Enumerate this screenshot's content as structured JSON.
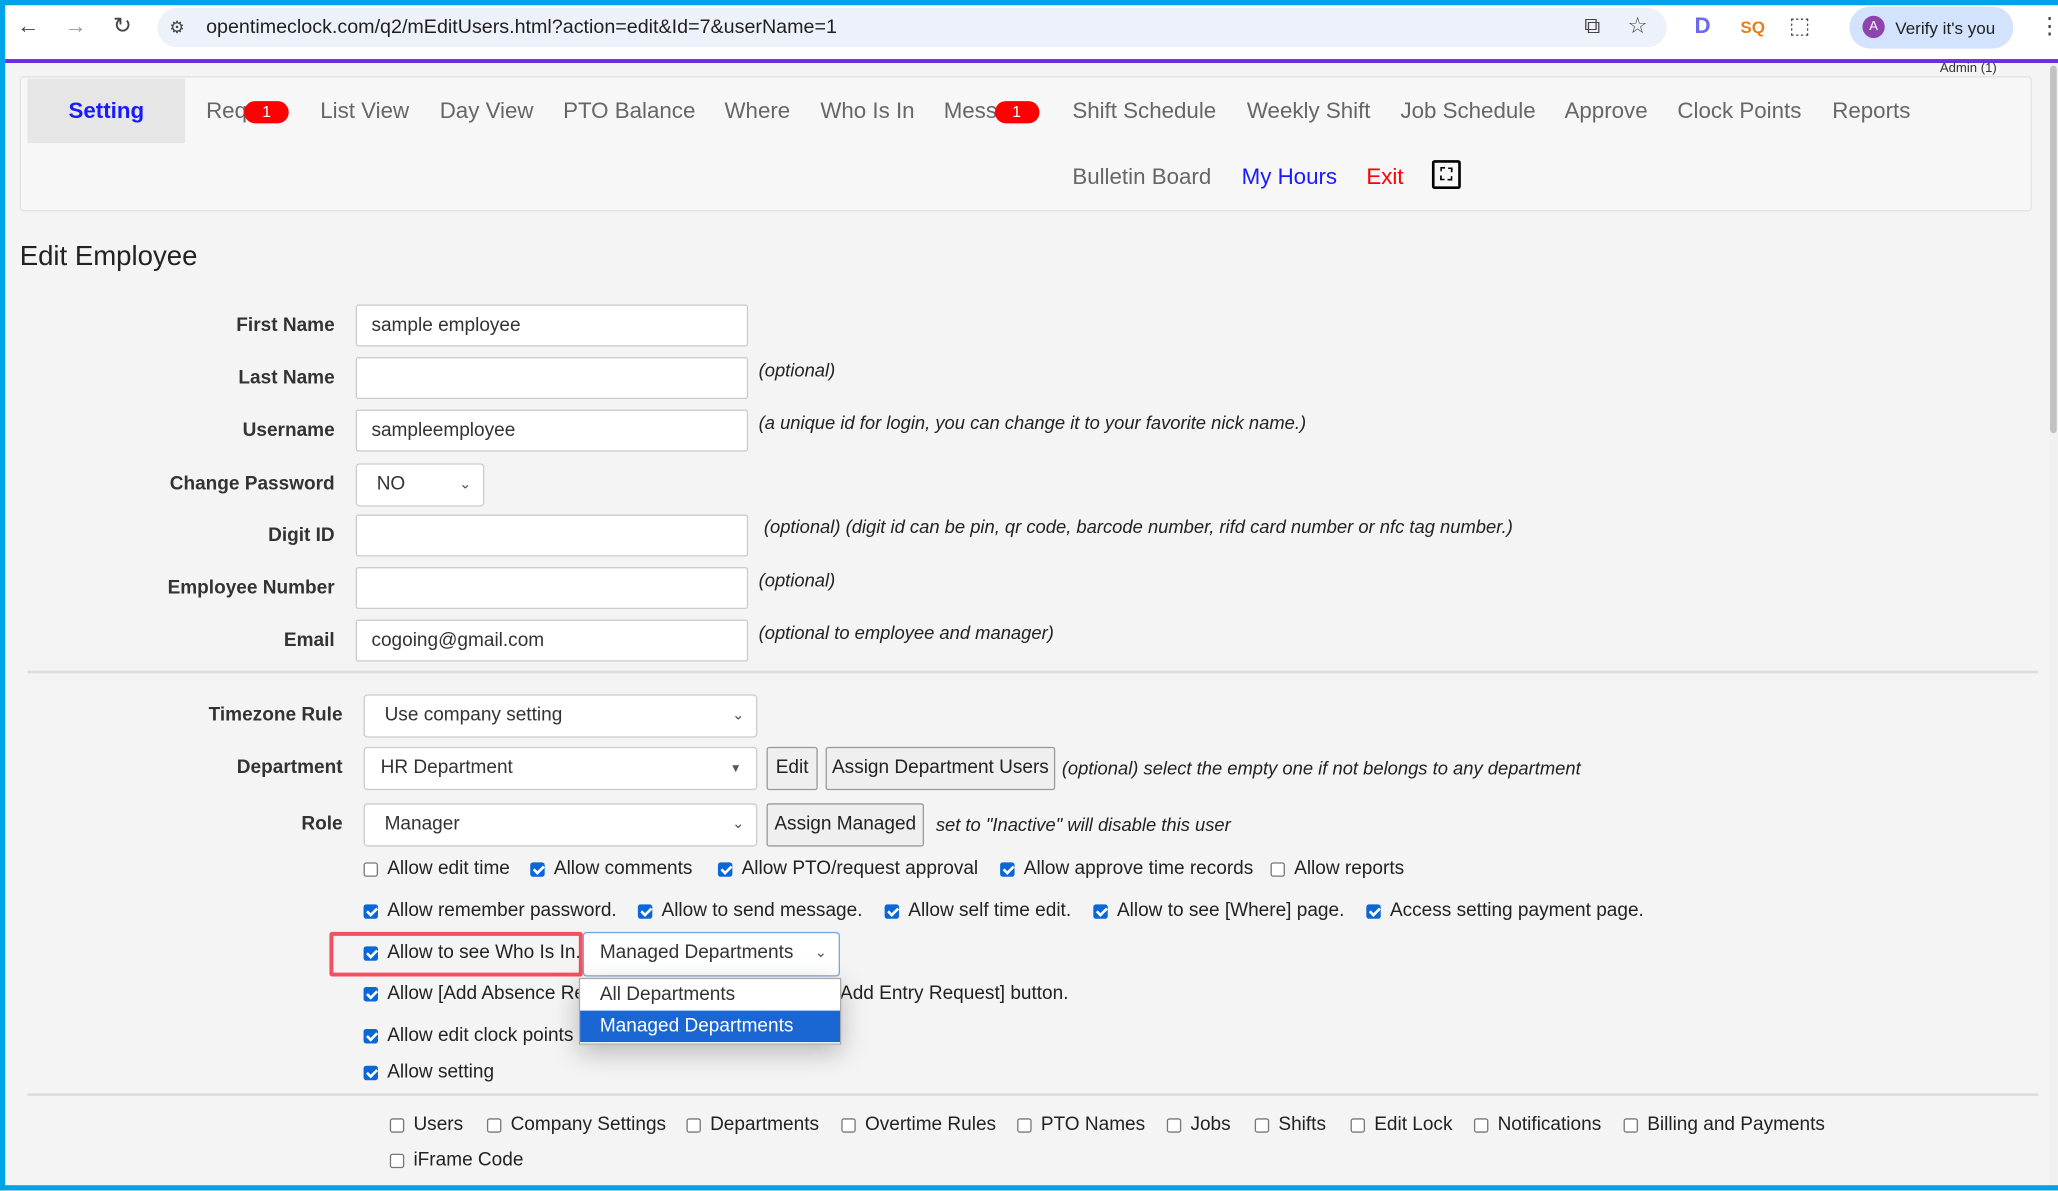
{
  "browser": {
    "url": "opentimeclock.com/q2/mEditUsers.html?action=edit&Id=7&userName=1",
    "profile_button": "Verify it's you",
    "profile_initial": "A",
    "icons": [
      "back-icon",
      "forward-icon",
      "reload-icon",
      "site-settings-icon",
      "install-icon",
      "star-icon",
      "extension-d-icon",
      "extension-sq-icon",
      "extensions-icon",
      "menu-icon"
    ]
  },
  "header": {
    "admin_label": "Admin (1)"
  },
  "nav": {
    "row1": [
      {
        "label": "Setting",
        "active": true
      },
      {
        "label": "Req",
        "badge": "1"
      },
      {
        "label": "List View"
      },
      {
        "label": "Day View"
      },
      {
        "label": "PTO Balance"
      },
      {
        "label": "Where"
      },
      {
        "label": "Who Is In"
      },
      {
        "label": "Mess",
        "badge": "1"
      },
      {
        "label": "Shift Schedule"
      },
      {
        "label": "Weekly Shift"
      },
      {
        "label": "Job Schedule"
      },
      {
        "label": "Approve"
      },
      {
        "label": "Clock Points"
      },
      {
        "label": "Reports"
      }
    ],
    "row2": [
      {
        "label": "Bulletin Board"
      },
      {
        "label": "My Hours",
        "color": "#1a1aff"
      },
      {
        "label": "Exit",
        "color": "#ff0000"
      }
    ],
    "fullscreen_icon": "fullscreen-icon"
  },
  "page_title": "Edit Employee",
  "form": {
    "first_name": {
      "label": "First Name",
      "value": "sample employee"
    },
    "last_name": {
      "label": "Last Name",
      "value": "",
      "hint": "(optional)"
    },
    "username": {
      "label": "Username",
      "value": "sampleemployee",
      "hint": "(a unique id for login, you can change it to your favorite nick name.)"
    },
    "change_password": {
      "label": "Change Password",
      "value": "NO"
    },
    "digit_id": {
      "label": "Digit ID",
      "value": "",
      "hint": "(optional) (digit id can be pin, qr code, barcode number, rifd card number or nfc tag number.)"
    },
    "employee_number": {
      "label": "Employee Number",
      "value": "",
      "hint": "(optional)"
    },
    "email": {
      "label": "Email",
      "value": "cogoing@gmail.com",
      "hint": "(optional to employee and manager)"
    },
    "timezone": {
      "label": "Timezone Rule",
      "value": "Use company setting"
    },
    "department": {
      "label": "Department",
      "value": "HR Department",
      "edit": "Edit",
      "assign": "Assign Department Users",
      "hint": "(optional) select the empty one if not belongs to any department"
    },
    "role": {
      "label": "Role",
      "value": "Manager",
      "assign": "Assign Managed",
      "hint": "set to \"Inactive\" will disable this user"
    }
  },
  "permissions": {
    "row1": [
      {
        "label": "Allow edit time",
        "checked": false
      },
      {
        "label": "Allow comments",
        "checked": true
      },
      {
        "label": "Allow PTO/request approval",
        "checked": true
      },
      {
        "label": "Allow approve time records",
        "checked": true
      },
      {
        "label": "Allow reports",
        "checked": false
      }
    ],
    "row2": [
      {
        "label": "Allow remember password.",
        "checked": true
      },
      {
        "label": "Allow to send message.",
        "checked": true
      },
      {
        "label": "Allow self time edit.",
        "checked": true
      },
      {
        "label": "Allow to see [Where] page.",
        "checked": true
      },
      {
        "label": "Access setting payment page.",
        "checked": true
      }
    ],
    "who_is_in": {
      "label": "Allow to see Who Is In.",
      "checked": true,
      "select_value": "Managed Departments",
      "options": [
        "All Departments",
        "Managed Departments"
      ],
      "selected_index": 1
    },
    "absence": {
      "label": "Allow [Add Absence Re",
      "label_tail": "Add Entry Request] button.",
      "checked": true
    },
    "edit_clock_points": {
      "label": "Allow edit clock points",
      "checked": true
    },
    "setting": {
      "label": "Allow setting",
      "checked": true
    }
  },
  "setting_permissions": [
    {
      "label": "Users",
      "checked": false
    },
    {
      "label": "Company Settings",
      "checked": false
    },
    {
      "label": "Departments",
      "checked": false
    },
    {
      "label": "Overtime Rules",
      "checked": false
    },
    {
      "label": "PTO Names",
      "checked": false
    },
    {
      "label": "Jobs",
      "checked": false
    },
    {
      "label": "Shifts",
      "checked": false
    },
    {
      "label": "Edit Lock",
      "checked": false
    },
    {
      "label": "Notifications",
      "checked": false
    },
    {
      "label": "Billing and Payments",
      "checked": false
    },
    {
      "label": "iFrame Code",
      "checked": false
    }
  ],
  "colors": {
    "accent": "#1a1aff",
    "badge": "#ff0000",
    "frame": "#00a3e8",
    "highlight": "#f25060",
    "selected_option": "#1a66d2"
  }
}
